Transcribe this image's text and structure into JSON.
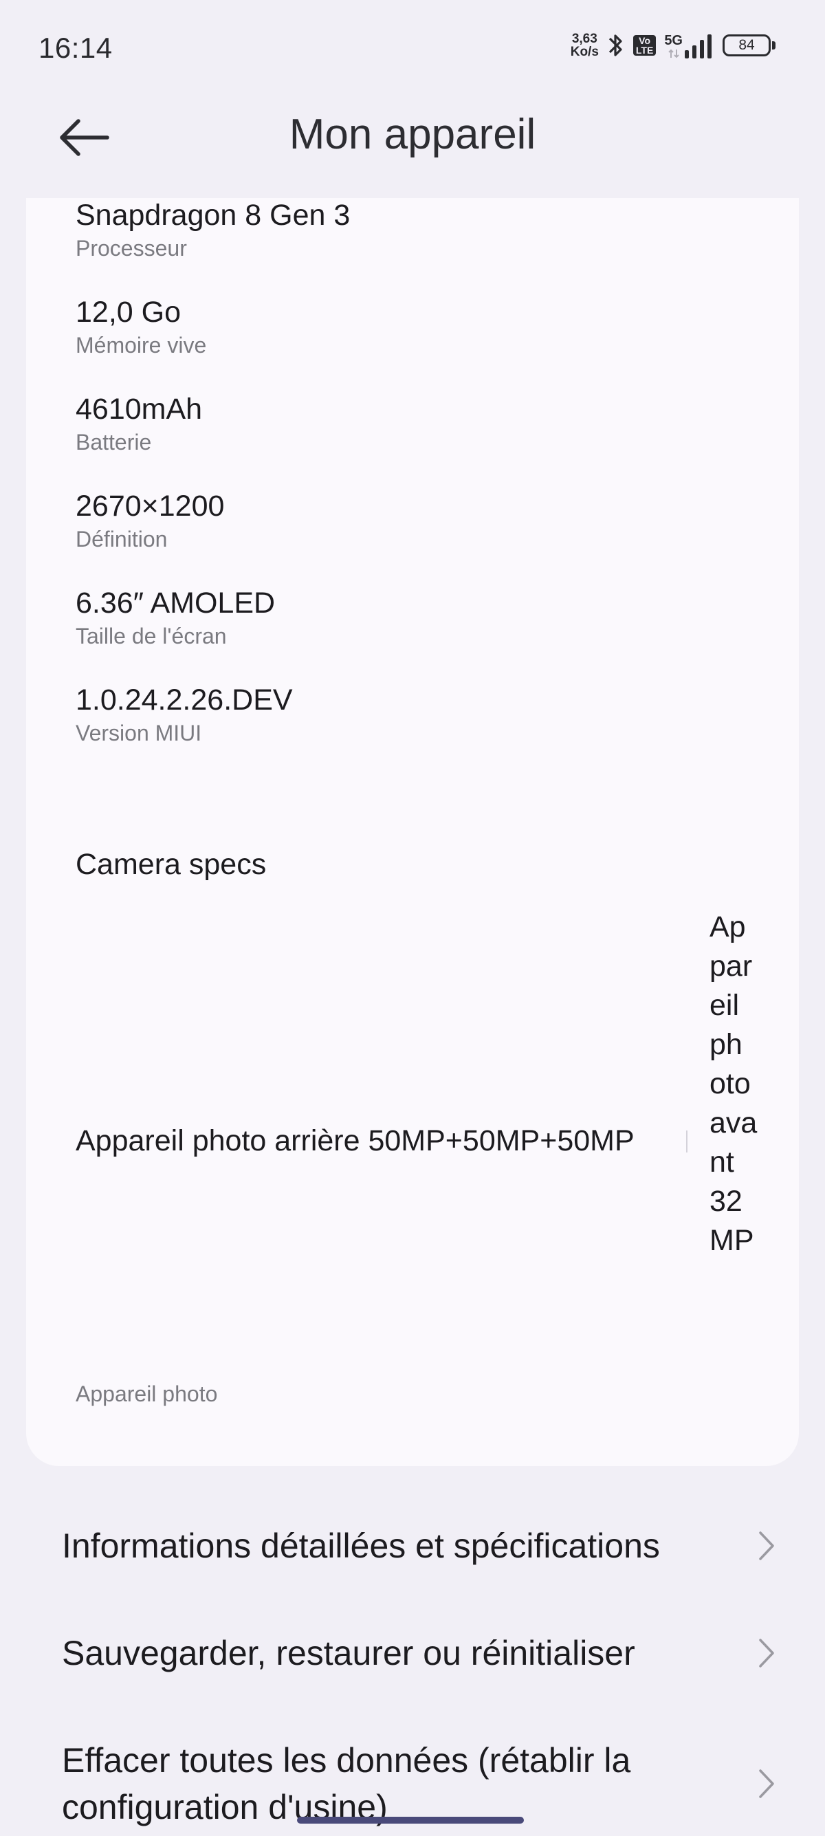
{
  "status_bar": {
    "time": "16:14",
    "net_speed_value": "3,63",
    "net_speed_unit": "Ko/s",
    "volte": "Vo\nLTE",
    "network": "5G",
    "battery": "84"
  },
  "header": {
    "title": "Mon appareil"
  },
  "specs": [
    {
      "value": "Snapdragon 8 Gen 3",
      "label": "Processeur"
    },
    {
      "value": "12,0  Go",
      "label": "Mémoire vive"
    },
    {
      "value": "4610mAh",
      "label": "Batterie"
    },
    {
      "value": "2670×1200",
      "label": "Définition"
    },
    {
      "value": "6.36″ AMOLED",
      "label": "Taille de l'écran"
    },
    {
      "value": "1.0.24.2.26.DEV",
      "label": "Version MIUI"
    }
  ],
  "camera": {
    "heading": "Camera specs",
    "rear": "Appareil photo arrière 50MP+50MP+50MP",
    "front": "Appareil photo avant 32MP",
    "label": "Appareil photo"
  },
  "menu": [
    {
      "label": "Informations détaillées et spécifications"
    },
    {
      "label": "Sauvegarder, restaurer ou réinitialiser"
    },
    {
      "label": "Effacer toutes les données (rétablir la configuration d'usine)"
    }
  ],
  "colors": {
    "background": "#f1eff6",
    "card": "#fbf9fd",
    "secondary_text": "#7a7a80",
    "gesture_bar": "#4a4a7a"
  }
}
